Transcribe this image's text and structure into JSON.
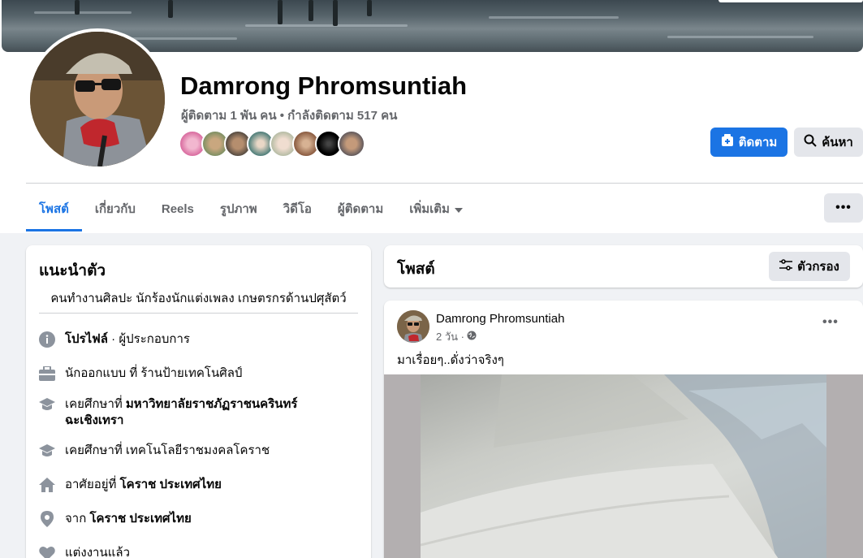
{
  "profile": {
    "name": "Damrong Phromsuntiah",
    "follow_stats": "ผู้ติดตาม 1 พัน คน • กำลังติดตาม 517 คน"
  },
  "actions": {
    "follow_label": "ติดตาม",
    "search_label": "ค้นหา",
    "more_label": "•••"
  },
  "tabs": [
    {
      "label": "โพสต์",
      "active": true
    },
    {
      "label": "เกี่ยวกับ"
    },
    {
      "label": "Reels"
    },
    {
      "label": "รูปภาพ"
    },
    {
      "label": "วิดีโอ"
    },
    {
      "label": "ผู้ติดตาม"
    },
    {
      "label": "เพิ่มเติม"
    }
  ],
  "intro": {
    "title": "แนะนำตัว",
    "bio": "คนทำงานศิลปะ นักร้องนักแต่งเพลง เกษตรกรด้านปศุสัตว์",
    "items": [
      {
        "icon": "info-icon",
        "bold": "โปรไฟล์",
        "rest": " · ผู้ประกอบการ"
      },
      {
        "icon": "briefcase-icon",
        "prefix": "นักออกแบบ ที่ ร้านป้ายเทคโนศิลป์"
      },
      {
        "icon": "graduation-cap-icon",
        "prefix": "เคยศึกษาที่ ",
        "bold": "มหาวิทยาลัยราชภัฏราชนครินทร์ ฉะเชิงเทรา"
      },
      {
        "icon": "graduation-cap-icon",
        "prefix": "เคยศึกษาที่ เทคโนโลยีราชมงคลโคราช"
      },
      {
        "icon": "home-icon",
        "prefix": "อาศัยอยู่ที่ ",
        "bold": "โคราช ประเทศไทย"
      },
      {
        "icon": "location-pin-icon",
        "prefix": "จาก ",
        "bold": "โคราช ประเทศไทย"
      },
      {
        "icon": "heart-icon",
        "prefix": "แต่งงานแล้ว"
      }
    ]
  },
  "posts_header": {
    "title": "โพสต์",
    "filter_label": "ตัวกรอง"
  },
  "post": {
    "author": "Damrong Phromsuntiah",
    "time": "2 วัน ·",
    "privacy_icon": "globe-icon",
    "text": "มาเรื่อยๆ..ดั่งว่าจริงๆ"
  },
  "colors": {
    "accent": "#1b74e4",
    "secondary_text": "#65676b",
    "button_gray": "#e4e6eb",
    "page_bg": "#f0f2f5"
  }
}
